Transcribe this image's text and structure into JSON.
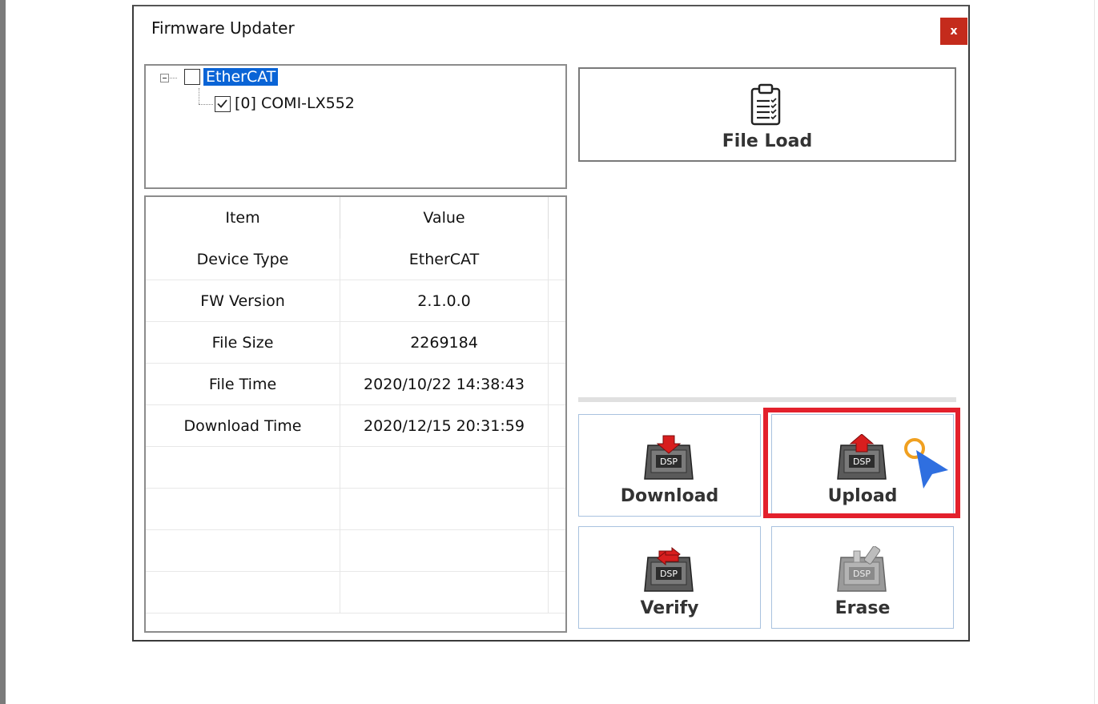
{
  "window": {
    "title": "Firmware Updater",
    "close_label": "x"
  },
  "tree": {
    "root": {
      "label": "EtherCAT",
      "checked": false,
      "selected": true
    },
    "children": [
      {
        "label": "[0] COMI-LX552",
        "checked": true
      }
    ]
  },
  "grid": {
    "headers": [
      "Item",
      "Value"
    ],
    "rows": [
      [
        "Device Type",
        "EtherCAT"
      ],
      [
        "FW Version",
        "2.1.0.0"
      ],
      [
        "File Size",
        "2269184"
      ],
      [
        "File Time",
        "2020/10/22 14:38:43"
      ],
      [
        "Download Time",
        "2020/12/15 20:31:59"
      ]
    ]
  },
  "buttons": {
    "file_load": "File Load",
    "download": "Download",
    "upload": "Upload",
    "verify": "Verify",
    "erase": "Erase"
  },
  "icons": {
    "file_load": "clipboard-icon",
    "download": "dsp-download-icon",
    "upload": "dsp-upload-icon",
    "verify": "dsp-verify-icon",
    "erase": "dsp-erase-icon",
    "dsp_text": "DSP"
  },
  "colors": {
    "close": "#c42b1c",
    "selection": "#0a64d6",
    "highlight": "#e3202c",
    "cursor": "#2f6fe0",
    "button_border": "#a9c2df"
  }
}
